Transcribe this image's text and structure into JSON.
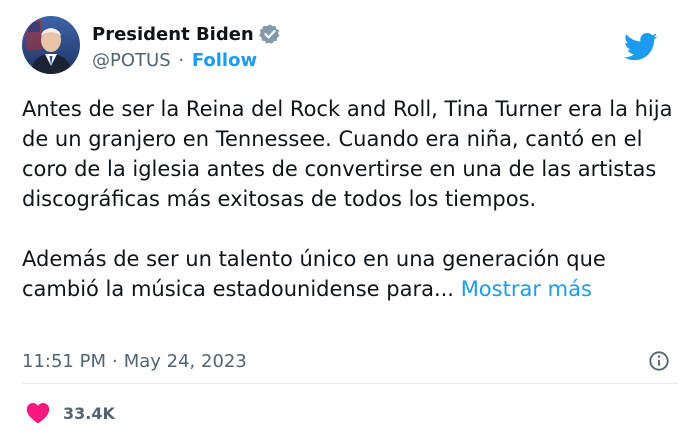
{
  "author": {
    "display_name": "President Biden",
    "handle": "@POTUS",
    "separator": "·",
    "follow_label": "Follow",
    "verified": true
  },
  "icons": {
    "avatar": "avatar-portrait",
    "verified": "verified-badge-icon",
    "brand": "twitter-bird-icon",
    "info": "info-icon",
    "like": "heart-icon"
  },
  "tweet": {
    "paragraph1": "Antes de ser la Reina del Rock and Roll, Tina Turner era la hija de un granjero en Tennessee. Cuando era niña, cantó en el coro de la iglesia antes de convertirse en una de las artistas discográficas más exitosas de todos los tiempos.",
    "paragraph2": "Además de ser un talento único en una generación que cambió la música estadounidense para...",
    "show_more_label": "Mostrar más"
  },
  "meta": {
    "time": "11:51 PM",
    "separator": "·",
    "date": "May 24, 2023"
  },
  "stats": {
    "likes": "33.4K"
  },
  "colors": {
    "accent": "#1d9bf0",
    "like": "#f91880",
    "text": "#0f1419",
    "secondary": "#536471",
    "divider": "#e6ecf0"
  }
}
